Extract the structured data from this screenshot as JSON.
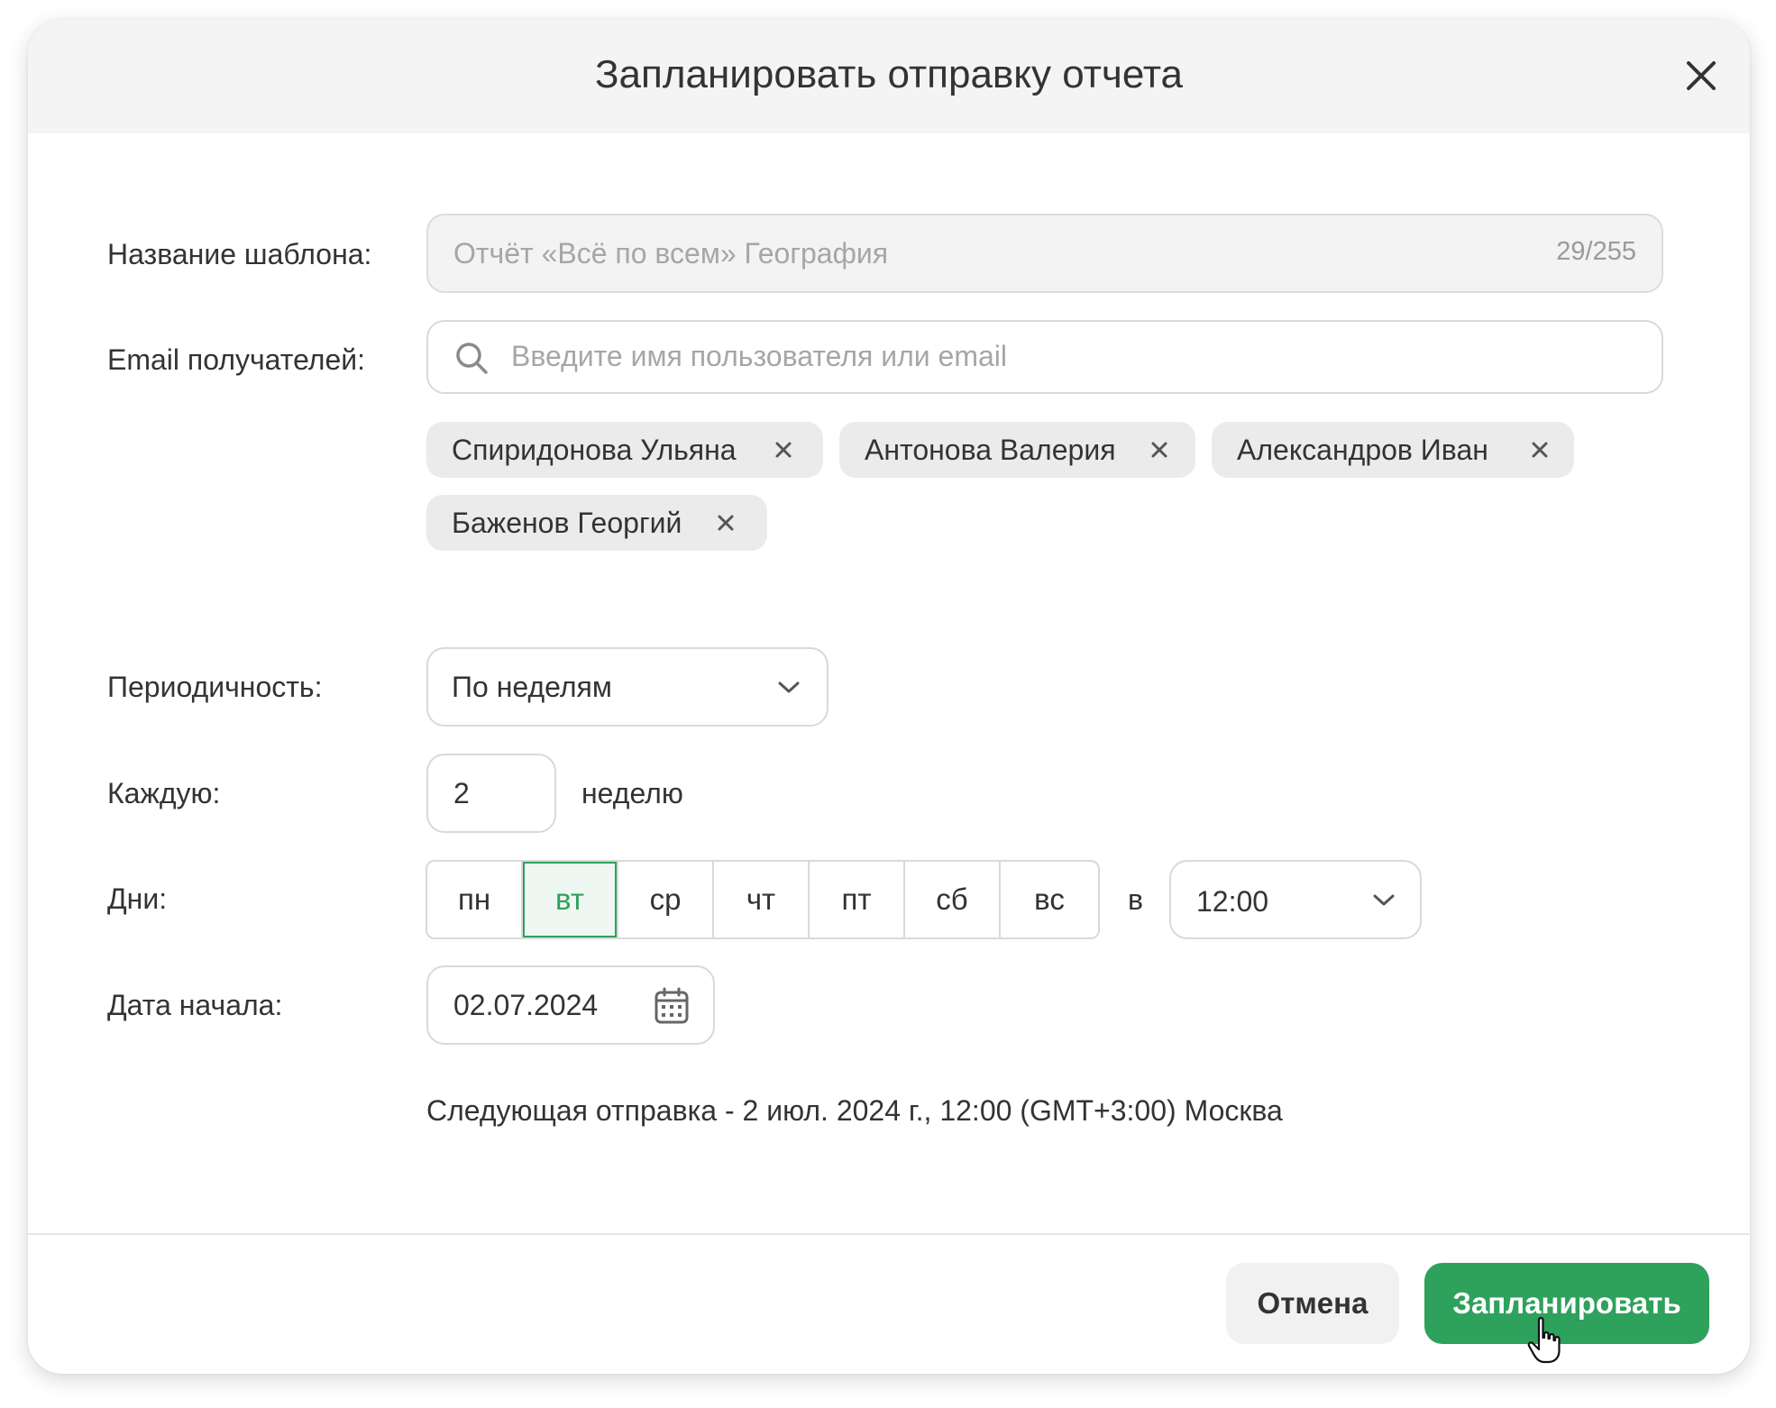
{
  "dialog": {
    "title": "Запланировать отправку отчета"
  },
  "template_name": {
    "label": "Название шаблона:",
    "value": "Отчёт «Всё по всем» География",
    "counter": "29/255"
  },
  "recipients": {
    "label": "Email получателей:",
    "placeholder": "Введите имя пользователя или email",
    "chips": [
      {
        "label": "Спиридонова Ульяна"
      },
      {
        "label": "Антонова Валерия"
      },
      {
        "label": "Александров Иван"
      },
      {
        "label": "Баженов Георгий"
      }
    ]
  },
  "periodicity": {
    "label": "Периодичность:",
    "value": "По неделям"
  },
  "every": {
    "label": "Каждую:",
    "value": "2",
    "unit": "неделю"
  },
  "days": {
    "label": "Дни:",
    "items": [
      {
        "label": "пн",
        "selected": false
      },
      {
        "label": "вт",
        "selected": true
      },
      {
        "label": "ср",
        "selected": false
      },
      {
        "label": "чт",
        "selected": false
      },
      {
        "label": "пт",
        "selected": false
      },
      {
        "label": "сб",
        "selected": false
      },
      {
        "label": "вс",
        "selected": false
      }
    ],
    "at_label": "в",
    "time": "12:00"
  },
  "start_date": {
    "label": "Дата начала:",
    "value": "02.07.2024"
  },
  "next_send": "Следующая отправка - 2 июл. 2024 г., 12:00 (GMT+3:00) Москва",
  "footer": {
    "cancel_label": "Отмена",
    "submit_label": "Запланировать"
  },
  "colors": {
    "accent": "#2ea15c",
    "header_bg": "#f4f4f4",
    "chip_bg": "#ebebeb"
  }
}
